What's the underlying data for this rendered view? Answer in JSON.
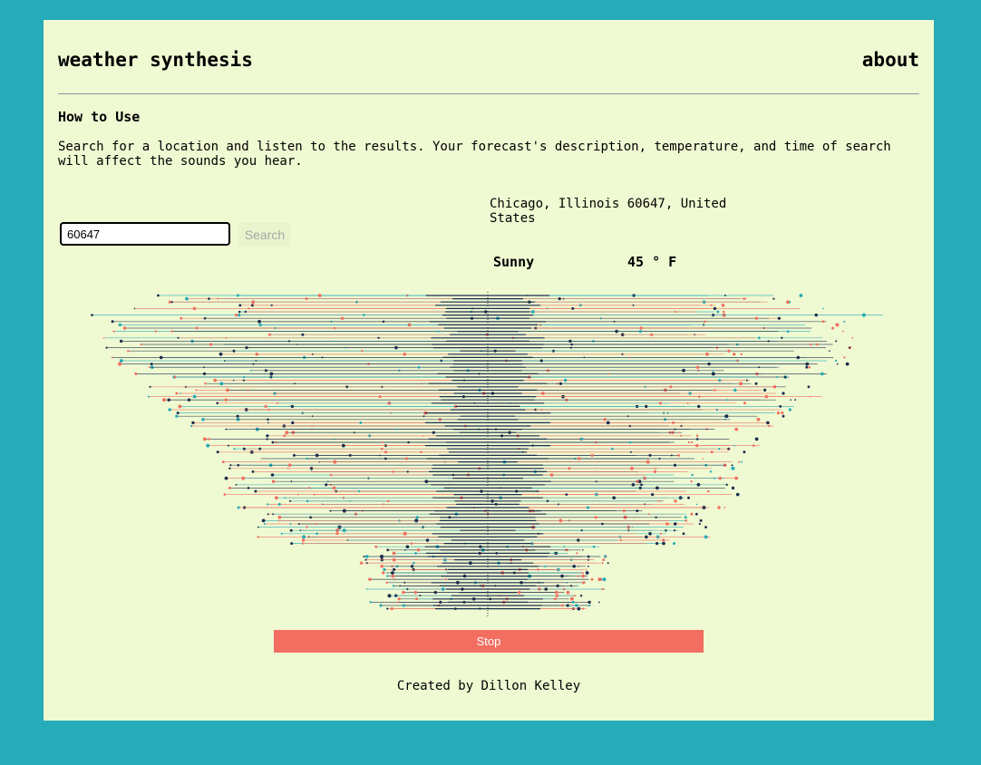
{
  "header": {
    "title": "weather synthesis",
    "about_label": "about"
  },
  "how_to": {
    "heading": "How to Use",
    "text": "Search for a location and listen to the results. Your forecast's description, temperature, and time of search will affect the sounds you hear."
  },
  "search": {
    "value": "60647",
    "button_label": "Search"
  },
  "forecast": {
    "location": "Chicago, Illinois 60647, United States",
    "description": "Sunny",
    "temperature": "45 ° F"
  },
  "visualizer": {
    "colors": {
      "navy": "#1c2d4d",
      "coral": "#f26e60",
      "teal": "#26abb8"
    }
  },
  "controls": {
    "stop_label": "Stop"
  },
  "footer": {
    "credit": "Created by Dillon Kelley"
  },
  "colors": {
    "background": "#26abb8",
    "card": "#eff9d2",
    "accent": "#f26e60"
  }
}
